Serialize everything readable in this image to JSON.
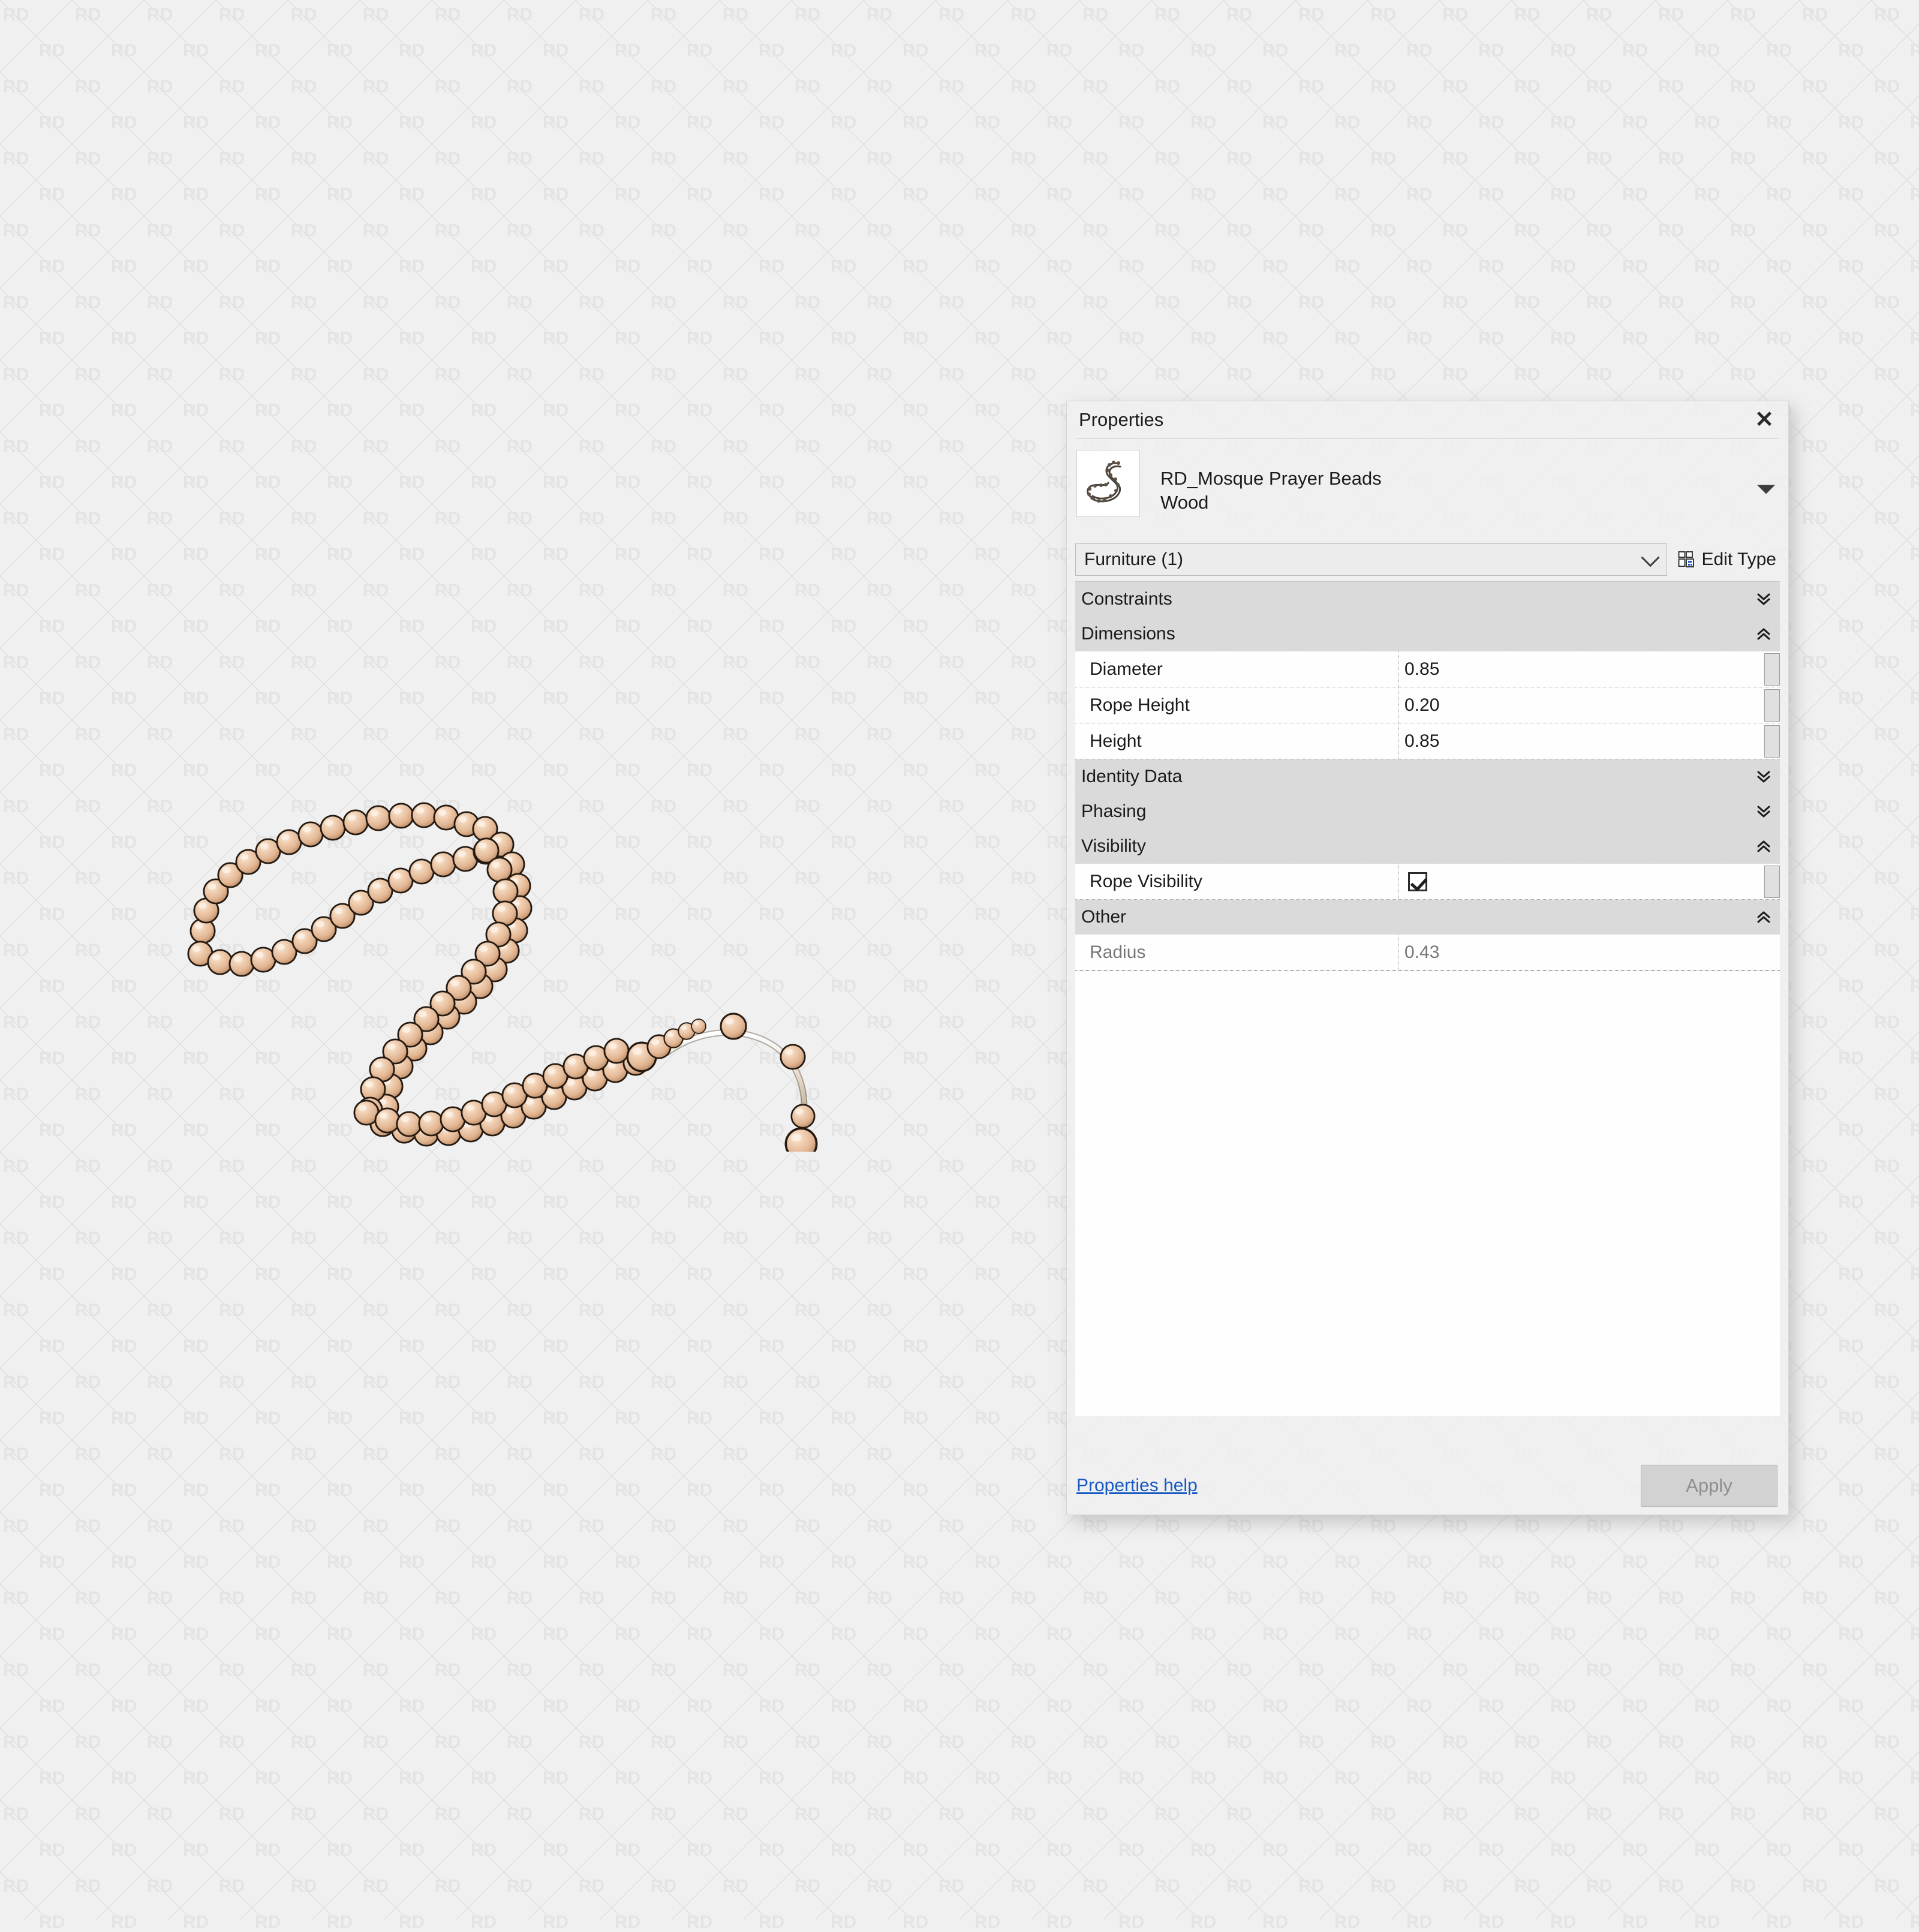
{
  "canvas": {
    "background_color": "#f0f0f0",
    "watermark_text": "RD",
    "watermark_color": "#e4e4e4"
  },
  "artwork": {
    "name": "prayer-beads-3d-model",
    "description": "RD_Mosque Prayer Beads Wood",
    "bead_color": "#e8c0a0",
    "bead_highlight": "#f7e2d0",
    "bead_shadow": "#b88a64",
    "outline_color": "#2a2018",
    "rope_color": "#efe6d8"
  },
  "panel": {
    "title": "Properties",
    "close_label": "✕",
    "type_thumbnail_icon": "prayer-beads-thumbnail",
    "family_name": "RD_Mosque Prayer Beads",
    "type_name": "Wood",
    "type_dropdown_icon": "triangle-down-icon",
    "selector": {
      "value": "Furniture (1)",
      "caret_icon": "chevron-down-icon"
    },
    "edit_type": {
      "label": "Edit Type",
      "icon": "edit-type-icon"
    },
    "sections": [
      {
        "name": "Constraints",
        "collapsed": true,
        "chevron": "chevron-double-down-icon",
        "rows": []
      },
      {
        "name": "Dimensions",
        "collapsed": false,
        "chevron": "chevron-double-up-icon",
        "rows": [
          {
            "label": "Diameter",
            "value": "0.85",
            "type": "text",
            "readonly": false
          },
          {
            "label": "Rope Height",
            "value": "0.20",
            "type": "text",
            "readonly": false
          },
          {
            "label": "Height",
            "value": "0.85",
            "type": "text",
            "readonly": false
          }
        ]
      },
      {
        "name": "Identity Data",
        "collapsed": true,
        "chevron": "chevron-double-down-icon",
        "rows": []
      },
      {
        "name": "Phasing",
        "collapsed": true,
        "chevron": "chevron-double-down-icon",
        "rows": []
      },
      {
        "name": "Visibility",
        "collapsed": false,
        "chevron": "chevron-double-up-icon",
        "rows": [
          {
            "label": "Rope Visibility",
            "value": "",
            "type": "checkbox",
            "checked": true,
            "readonly": false
          }
        ]
      },
      {
        "name": "Other",
        "collapsed": false,
        "chevron": "chevron-double-up-icon",
        "rows": [
          {
            "label": "Radius",
            "value": "0.43",
            "type": "text",
            "readonly": true
          }
        ]
      }
    ],
    "footer": {
      "help_link": "Properties help",
      "apply_label": "Apply",
      "apply_enabled": false
    }
  },
  "colors": {
    "link": "#1559c4",
    "section_header_bg": "#d6d6d6",
    "panel_bg": "#f0f0f0",
    "row_bg": "#ffffff"
  }
}
